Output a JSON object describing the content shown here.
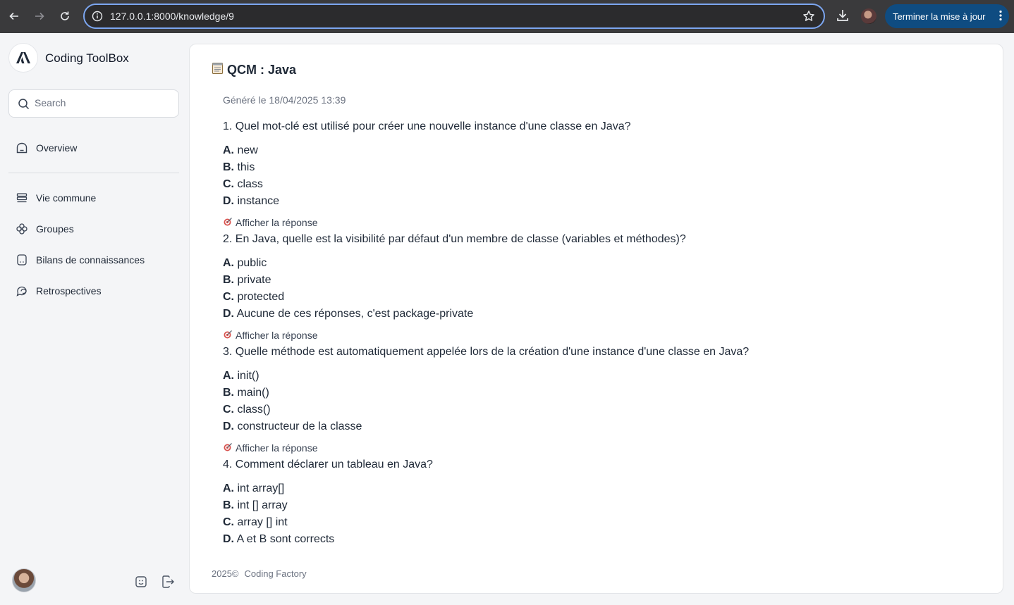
{
  "browser": {
    "url": "127.0.0.1:8000/knowledge/9",
    "update_label": "Terminer la mise à jour"
  },
  "sidebar": {
    "app_name": "Coding ToolBox",
    "search_placeholder": "Search",
    "items": [
      {
        "label": "Overview",
        "icon": "home-icon"
      },
      {
        "label": "Vie commune",
        "icon": "stack-icon"
      },
      {
        "label": "Groupes",
        "icon": "flower-icon"
      },
      {
        "label": "Bilans de connaissances",
        "icon": "document-icon"
      },
      {
        "label": "Retrospectives",
        "icon": "chat-icon"
      }
    ]
  },
  "main": {
    "title": "QCM : Java",
    "generated": "Généré le 18/04/2025 13:39",
    "reveal_label": "Afficher la réponse",
    "questions": [
      {
        "text": "1. Quel mot-clé est utilisé pour créer une nouvelle instance d'une classe en Java?",
        "options": [
          {
            "letter": "A.",
            "text": "new"
          },
          {
            "letter": "B.",
            "text": "this"
          },
          {
            "letter": "C.",
            "text": "class"
          },
          {
            "letter": "D.",
            "text": "instance"
          }
        ]
      },
      {
        "text": "2. En Java, quelle est la visibilité par défaut d'un membre de classe (variables et méthodes)?",
        "options": [
          {
            "letter": "A.",
            "text": "public"
          },
          {
            "letter": "B.",
            "text": "private"
          },
          {
            "letter": "C.",
            "text": "protected"
          },
          {
            "letter": "D.",
            "text": "Aucune de ces réponses, c'est package-private"
          }
        ]
      },
      {
        "text": "3. Quelle méthode est automatiquement appelée lors de la création d'une instance d'une classe en Java?",
        "options": [
          {
            "letter": "A.",
            "text": "init()"
          },
          {
            "letter": "B.",
            "text": "main()"
          },
          {
            "letter": "C.",
            "text": "class()"
          },
          {
            "letter": "D.",
            "text": "constructeur de la classe"
          }
        ]
      },
      {
        "text": "4. Comment déclarer un tableau en Java?",
        "options": [
          {
            "letter": "A.",
            "text": "int array[]"
          },
          {
            "letter": "B.",
            "text": "int [] array"
          },
          {
            "letter": "C.",
            "text": "array [] int"
          },
          {
            "letter": "D.",
            "text": "A et B sont corrects"
          }
        ]
      }
    ]
  },
  "footer": {
    "year": "2025©",
    "brand": "Coding Factory"
  }
}
